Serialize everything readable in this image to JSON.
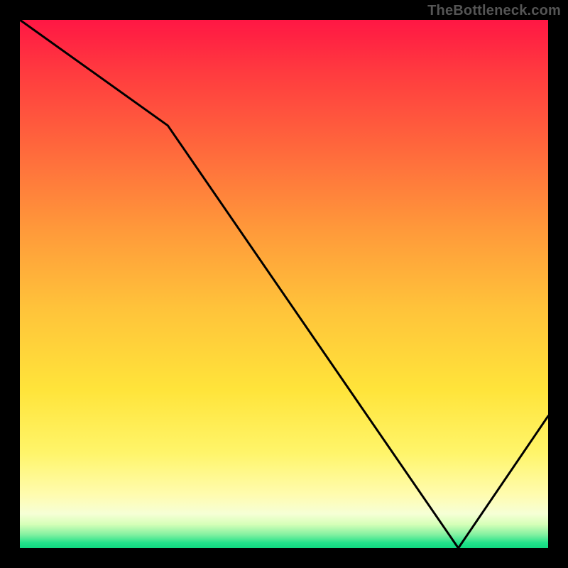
{
  "watermark": "TheBottleneck.com",
  "tiny_label": "",
  "chart_data": {
    "type": "line",
    "title": "",
    "xlabel": "",
    "ylabel": "",
    "xlim": [
      0,
      100
    ],
    "ylim": [
      0,
      100
    ],
    "grid": false,
    "x": [
      0,
      28,
      83,
      100
    ],
    "y": [
      100,
      80,
      0,
      25
    ],
    "annotations": [
      {
        "text": "",
        "x": 80,
        "y": 1
      }
    ],
    "background_gradient_stops": [
      {
        "offset": 0.0,
        "color": "#ff1744"
      },
      {
        "offset": 0.1,
        "color": "#ff3b3f"
      },
      {
        "offset": 0.25,
        "color": "#ff6a3c"
      },
      {
        "offset": 0.4,
        "color": "#ff9a3a"
      },
      {
        "offset": 0.55,
        "color": "#ffc43a"
      },
      {
        "offset": 0.7,
        "color": "#ffe43a"
      },
      {
        "offset": 0.82,
        "color": "#fff56a"
      },
      {
        "offset": 0.9,
        "color": "#fffcb0"
      },
      {
        "offset": 0.935,
        "color": "#f6ffd6"
      },
      {
        "offset": 0.955,
        "color": "#d6ffb8"
      },
      {
        "offset": 0.975,
        "color": "#80f0a0"
      },
      {
        "offset": 0.99,
        "color": "#22e28a"
      },
      {
        "offset": 1.0,
        "color": "#10d880"
      }
    ]
  }
}
